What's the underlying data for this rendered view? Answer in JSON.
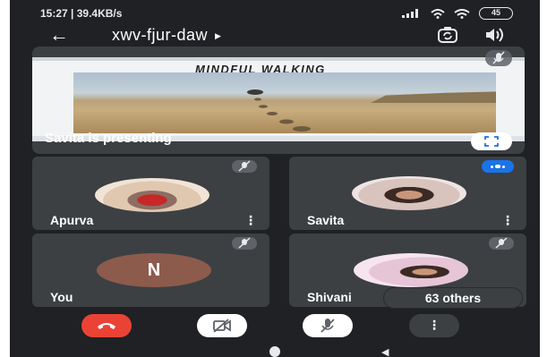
{
  "status_bar": {
    "time_speed": "15:27 | 39.4KB/s",
    "battery": "45"
  },
  "header": {
    "meeting_code": "xwv-fjur-daw",
    "back_icon": "arrow-left-icon",
    "camera_switch_icon": "camera-flip-icon",
    "audio_icon": "speaker-icon"
  },
  "presentation": {
    "slide_title": "MINDFUL WALKING",
    "presenter_label": "Savita is presenting"
  },
  "participants": [
    {
      "name": "Apurva",
      "muted": true
    },
    {
      "name": "Savita",
      "speaking": true
    },
    {
      "name": "You",
      "initial": "N",
      "muted": true
    },
    {
      "name": "Shivani",
      "muted": true
    }
  ],
  "others_label": "63 others",
  "controls": {
    "end_call_icon": "phone-hangup-icon",
    "video_icon": "video-off-icon",
    "mic_icon": "mic-off-icon",
    "more_icon": "more-vert-icon"
  },
  "colors": {
    "background": "#202124",
    "tile": "#3c4043",
    "end_call": "#ea4335",
    "speaking": "#1a73e8"
  }
}
